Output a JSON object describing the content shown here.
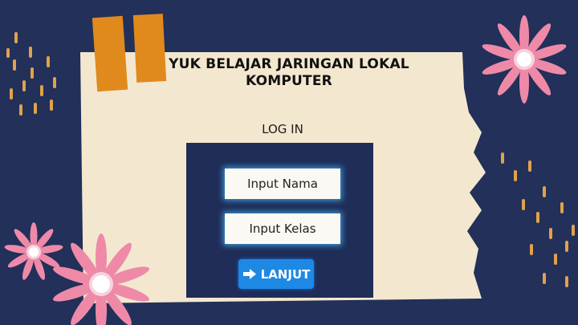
{
  "slide": {
    "title": "YUK BELAJAR JARINGAN LOKAL KOMPUTER",
    "login_label": "LOG IN"
  },
  "form": {
    "name_field_label": "Input Nama",
    "class_field_label": "Input Kelas",
    "submit_label": "LANJUT",
    "submit_icon": "arrow-right-icon"
  },
  "colors": {
    "background": "#22305a",
    "paper": "#f3e8cf",
    "panel": "#1f2d58",
    "button": "#1e88e5",
    "tape": "#e08a1e",
    "flower": "#ee8aa8",
    "dots": "#e0a24a"
  }
}
